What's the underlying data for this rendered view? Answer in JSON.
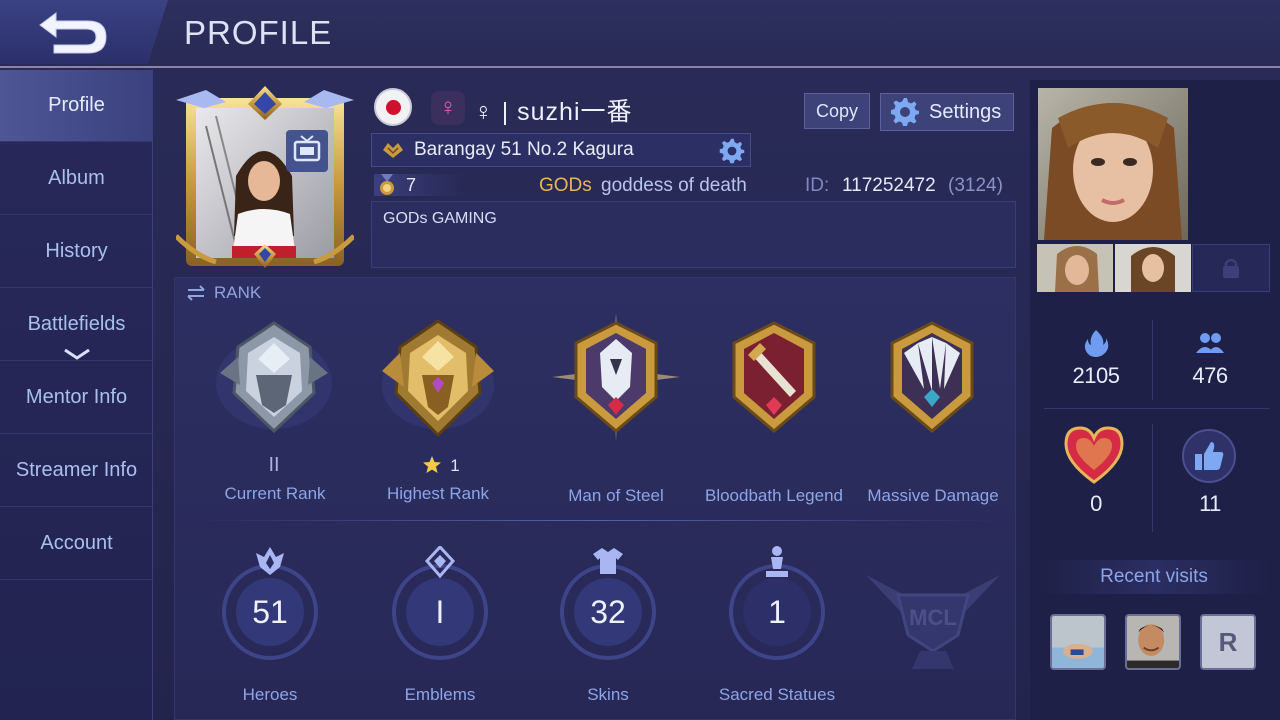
{
  "header": {
    "title": "PROFILE",
    "back_icon": "back-arrow-icon"
  },
  "sidebar": {
    "items": [
      {
        "label": "Profile",
        "active": true
      },
      {
        "label": "Album"
      },
      {
        "label": "History"
      },
      {
        "label": "Battlefields"
      },
      {
        "label": "Mentor Info"
      },
      {
        "label": "Streamer Info"
      },
      {
        "label": "Account"
      }
    ]
  },
  "profile": {
    "gender_symbol": "♀",
    "username": "♀ | suzhi一番",
    "copy_label": "Copy",
    "settings_label": "Settings",
    "squad": "Barangay 51 No.2 Kagura",
    "level": "7",
    "tag_name": "GODs",
    "tag_rest": "goddess of death",
    "id_label": "ID:",
    "id_value": "117252472",
    "id_server": "(3124)",
    "signature": "GODs GAMING",
    "flag_country": "Japan"
  },
  "rank": {
    "header": "RANK",
    "current_rank_tier": "II",
    "current_rank_label": "Current Rank",
    "highest_rank_stars": "1",
    "highest_rank_label": "Highest Rank",
    "achievements": [
      {
        "label": "Man of Steel"
      },
      {
        "label": "Bloodbath Legend"
      },
      {
        "label": "Massive Damage"
      }
    ]
  },
  "stats": [
    {
      "value": "51",
      "label": "Heroes",
      "icon": "heroes-icon"
    },
    {
      "value": "I",
      "label": "Emblems",
      "icon": "emblem-icon"
    },
    {
      "value": "32",
      "label": "Skins",
      "icon": "skins-icon"
    },
    {
      "value": "1",
      "label": "Sacred Statues",
      "icon": "statue-icon"
    }
  ],
  "mcl_logo_text": "MCL",
  "social": {
    "popularity": "2105",
    "followers": "476",
    "likes_heart": "0",
    "likes_thumb": "11"
  },
  "recent": {
    "title": "Recent visits",
    "third_visitor_initial": "R"
  },
  "colors": {
    "gold": "#e8b55a",
    "accent_blue": "#8ea5e6",
    "flag_red": "#d0102c"
  }
}
